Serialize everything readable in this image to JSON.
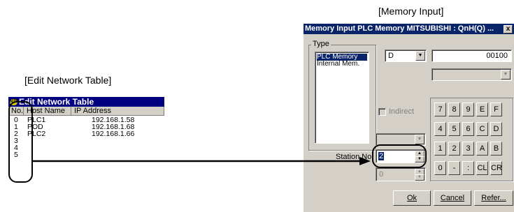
{
  "captions": {
    "memory_input": "[Memory Input]",
    "edit_network_table": "[Edit Network Table]"
  },
  "network_table": {
    "title": "Edit Network Table",
    "icon": "ntb-icon",
    "columns": [
      "No.",
      "Host Name",
      "IP Address"
    ],
    "numbers": [
      "0",
      "1",
      "2",
      "3",
      "4",
      "5"
    ],
    "rows": [
      {
        "host": "PLC1",
        "ip": "192.168.1.58"
      },
      {
        "host": "POD",
        "ip": "192.168.1.68"
      },
      {
        "host": "PLC2",
        "ip": "192.168.1.66"
      }
    ]
  },
  "memory_input": {
    "title": "Memory Input  PLC Memory MITSUBISHI : QnH(Q) ...",
    "close_label": "x",
    "type_group_label": "Type",
    "type_list": [
      "PLC Memory",
      "Internal Mem."
    ],
    "type_selected": "PLC Memory",
    "device_select": "D",
    "address_value": "00100",
    "indirect_label": "Indirect",
    "station_label": "Station No.",
    "station_value": "2",
    "lower_value": "0",
    "keypad": [
      [
        "7",
        "8",
        "9",
        "E",
        "F"
      ],
      [
        "4",
        "5",
        "6",
        "C",
        "D"
      ],
      [
        "1",
        "2",
        "3",
        "A",
        "B"
      ],
      [
        "0",
        "-",
        ":",
        "CL",
        "CR"
      ]
    ],
    "ok_label": "Ok",
    "cancel_label": "Cancel",
    "refer_label": "Refer..."
  },
  "colors": {
    "titlebar_blue": "#000080",
    "dialog_bg": "#d4d0c8",
    "selection": "#0a246a"
  }
}
